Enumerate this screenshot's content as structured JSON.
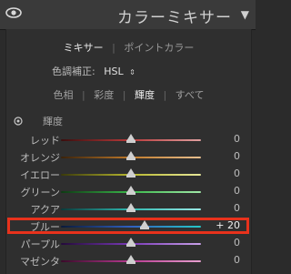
{
  "header": {
    "title": "カラーミキサー",
    "collapse_glyph": "▼",
    "visibility_icon": "eye-icon"
  },
  "modes": {
    "mixer": "ミキサー",
    "point_color": "ポイントカラー",
    "separator": "|"
  },
  "adjust": {
    "label": "色調補正:",
    "value": "HSL",
    "arrow": "⇕"
  },
  "tabs": [
    {
      "label": "色相",
      "active": false
    },
    {
      "label": "彩度",
      "active": false
    },
    {
      "label": "輝度",
      "active": true
    },
    {
      "label": "すべて",
      "active": false
    }
  ],
  "section": {
    "label": "輝度",
    "target_icon": "target-adjust-icon"
  },
  "sliders": [
    {
      "label": "レッド",
      "value": "0",
      "level": 0,
      "colors": [
        "#3a0e0e",
        "#b83a3a",
        "#e0a0a0"
      ]
    },
    {
      "label": "オレンジ",
      "value": "0",
      "level": 0,
      "colors": [
        "#3a220a",
        "#c07a2a",
        "#e8c090"
      ]
    },
    {
      "label": "イエロー",
      "value": "0",
      "level": 0,
      "colors": [
        "#3a3a0a",
        "#b8b830",
        "#e8e89a"
      ]
    },
    {
      "label": "グリーン",
      "value": "0",
      "level": 0,
      "colors": [
        "#0e3a14",
        "#3ab84a",
        "#a0e8a8"
      ]
    },
    {
      "label": "アクア",
      "value": "0",
      "level": 0,
      "colors": [
        "#0a3a3a",
        "#30b8b0",
        "#9ae8e4"
      ]
    },
    {
      "label": "ブルー",
      "value": "+ 20",
      "level": 20,
      "colors": [
        "#0a1a3a",
        "#3060c0",
        "#26c8c8"
      ]
    },
    {
      "label": "パープル",
      "value": "0",
      "level": 0,
      "colors": [
        "#240a3a",
        "#7a3ab8",
        "#c8a0e8"
      ]
    },
    {
      "label": "マゼンタ",
      "value": "0",
      "level": 0,
      "colors": [
        "#3a0a2a",
        "#b83a90",
        "#e8a0d0"
      ]
    }
  ],
  "highlight": {
    "row_index": 5,
    "color": "#e8321c"
  }
}
